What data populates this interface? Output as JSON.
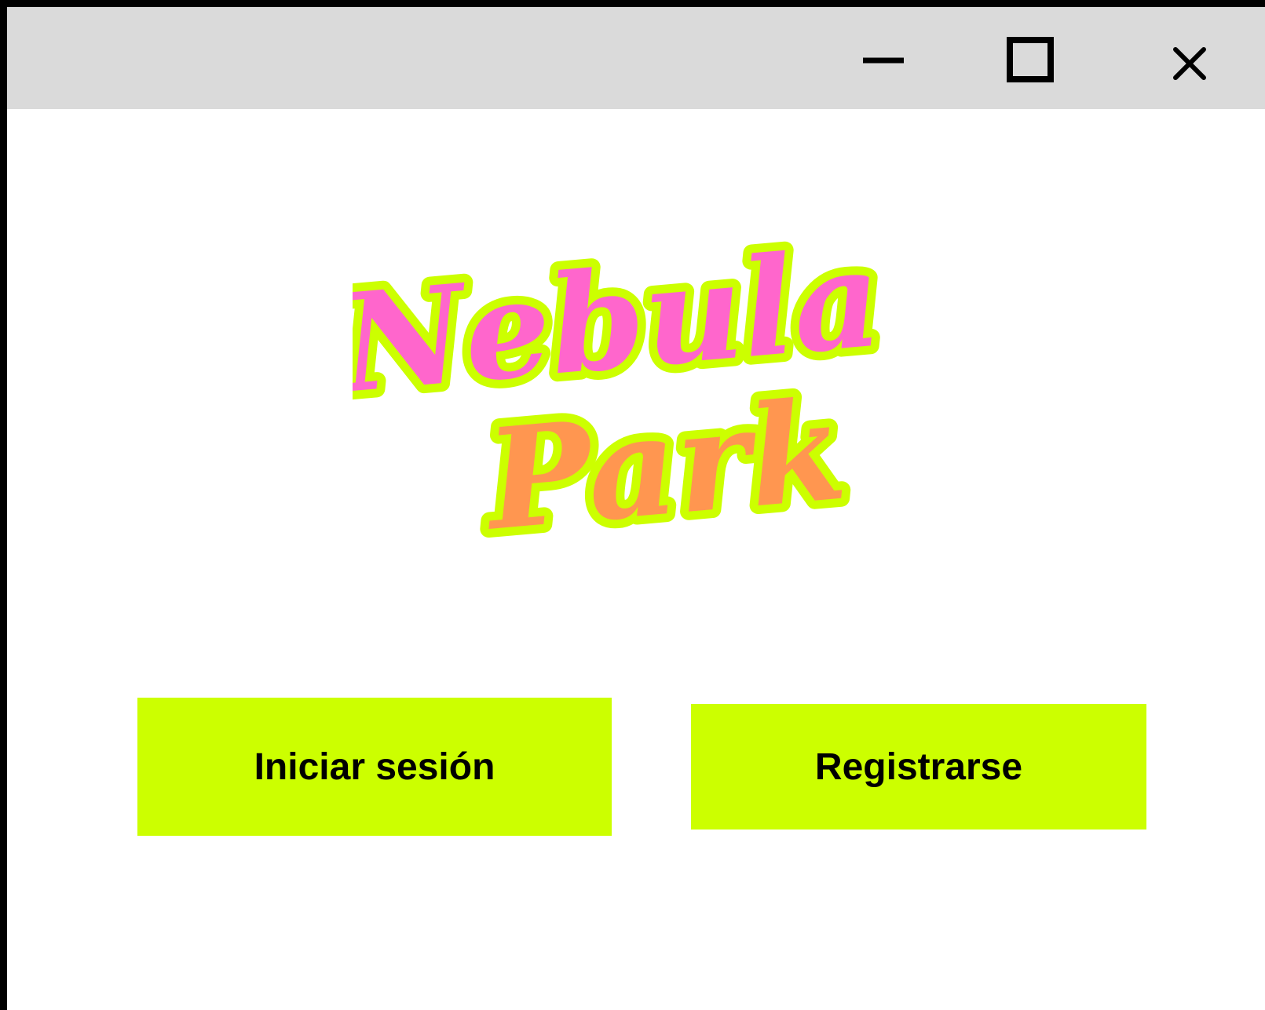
{
  "colors": {
    "titlebar_bg": "#dadada",
    "accent": "#ccff00",
    "logo_pink": "#ff66cc",
    "logo_orange": "#ff9650",
    "text": "#000000"
  },
  "window": {
    "controls": {
      "minimize_icon": "minimize-icon",
      "maximize_icon": "maximize-icon",
      "close_icon": "close-icon"
    }
  },
  "logo": {
    "line1": "Nebula",
    "line2": "Park"
  },
  "actions": {
    "login_label": "Iniciar sesión",
    "register_label": "Registrarse"
  }
}
